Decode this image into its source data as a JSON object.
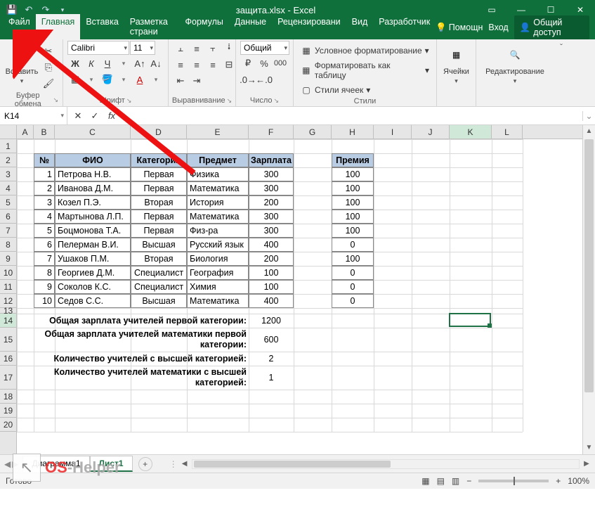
{
  "title": "защита.xlsx - Excel",
  "tabs": [
    "Файл",
    "Главная",
    "Вставка",
    "Разметка страни",
    "Формулы",
    "Данные",
    "Рецензировани",
    "Вид",
    "Разработчик"
  ],
  "active_tab": 1,
  "help_label": "Помощн",
  "signin_label": "Вход",
  "share_label": "Общий доступ",
  "ribbon": {
    "clipboard": {
      "paste": "Вставить",
      "label": "Буфер обмена"
    },
    "font": {
      "name": "Calibri",
      "size": "11",
      "label": "Шрифт"
    },
    "align": {
      "label": "Выравнивание"
    },
    "number": {
      "format": "Общий",
      "label": "Число"
    },
    "styles": {
      "cond": "Условное форматирование",
      "table": "Форматировать как таблицу",
      "cell": "Стили ячеек",
      "label": "Стили"
    },
    "cells": {
      "label": "Ячейки"
    },
    "editing": {
      "label": "Редактирование"
    }
  },
  "namebox": "K14",
  "columns": [
    {
      "l": "A",
      "w": 24
    },
    {
      "l": "B",
      "w": 30
    },
    {
      "l": "C",
      "w": 108
    },
    {
      "l": "D",
      "w": 80
    },
    {
      "l": "E",
      "w": 88
    },
    {
      "l": "F",
      "w": 64
    },
    {
      "l": "G",
      "w": 54
    },
    {
      "l": "H",
      "w": 60
    },
    {
      "l": "I",
      "w": 54
    },
    {
      "l": "J",
      "w": 54
    },
    {
      "l": "K",
      "w": 60
    },
    {
      "l": "L",
      "w": 44
    }
  ],
  "visible_rows": [
    1,
    2,
    3,
    4,
    5,
    6,
    7,
    8,
    9,
    10,
    11,
    12,
    13,
    14,
    15,
    16,
    17,
    18,
    19,
    20
  ],
  "row_heights": {
    "13": 8,
    "15": 34,
    "17": 34
  },
  "table": {
    "headers": [
      "№",
      "ФИО",
      "Категория",
      "Предмет",
      "Зарплата"
    ],
    "extra_header": "Премия",
    "rows": [
      {
        "n": 1,
        "fio": "Петрова Н.В.",
        "cat": "Первая",
        "subj": "Физика",
        "sal": 300,
        "bonus": 100
      },
      {
        "n": 2,
        "fio": "Иванова Д.М.",
        "cat": "Первая",
        "subj": "Математика",
        "sal": 300,
        "bonus": 100
      },
      {
        "n": 3,
        "fio": "Козел П.Э.",
        "cat": "Вторая",
        "subj": "История",
        "sal": 200,
        "bonus": 100
      },
      {
        "n": 4,
        "fio": "Мартынова Л.П.",
        "cat": "Первая",
        "subj": "Математика",
        "sal": 300,
        "bonus": 100
      },
      {
        "n": 5,
        "fio": "Боцмонова Т.А.",
        "cat": "Первая",
        "subj": "Физ-ра",
        "sal": 300,
        "bonus": 100
      },
      {
        "n": 6,
        "fio": "Пелерман В.И.",
        "cat": "Высшая",
        "subj": "Русский язык",
        "sal": 400,
        "bonus": 0
      },
      {
        "n": 7,
        "fio": "Ушаков П.М.",
        "cat": "Вторая",
        "subj": "Биология",
        "sal": 200,
        "bonus": 100
      },
      {
        "n": 8,
        "fio": "Георгиев Д.М.",
        "cat": "Специалист",
        "subj": "География",
        "sal": 100,
        "bonus": 0
      },
      {
        "n": 9,
        "fio": "Соколов К.С.",
        "cat": "Специалист",
        "subj": "Химия",
        "sal": 100,
        "bonus": 0
      },
      {
        "n": 10,
        "fio": "Седов С.С.",
        "cat": "Высшая",
        "subj": "Математика",
        "sal": 400,
        "bonus": 0
      }
    ]
  },
  "summaries": [
    {
      "label": "Общая зарплата учителей первой категории:",
      "value": 1200
    },
    {
      "label": "Общая зарплата учителей математики первой категории:",
      "value": 600
    },
    {
      "label": "Количество учителей с высшей категорией:",
      "value": 2
    },
    {
      "label": "Количество учителей математики с высшей категорией:",
      "value": 1
    }
  ],
  "sheets": {
    "tabs": [
      "Диаграмма1",
      "Лист1"
    ],
    "active": 1
  },
  "status": "Готово",
  "zoom": "100%",
  "selected_cell": "K14",
  "watermark": {
    "os": "OS",
    "help": "-Helper"
  }
}
